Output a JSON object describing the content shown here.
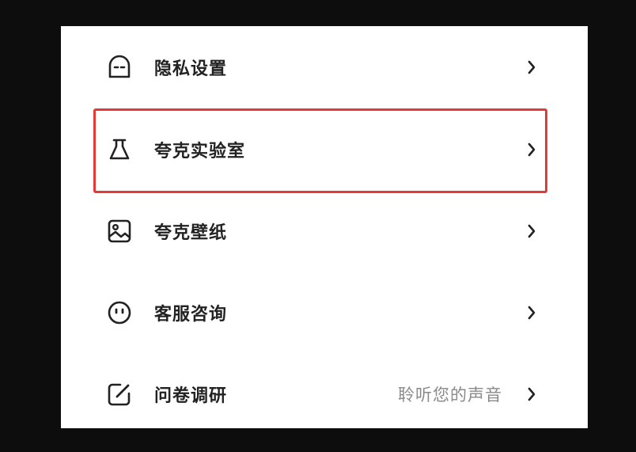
{
  "menu": {
    "items": [
      {
        "label": "隐私设置",
        "icon": "ghost-face-icon"
      },
      {
        "label": "夸克实验室",
        "icon": "flask-icon"
      },
      {
        "label": "夸克壁纸",
        "icon": "image-icon"
      },
      {
        "label": "客服咨询",
        "icon": "smiley-face-icon"
      },
      {
        "label": "问卷调研",
        "icon": "edit-square-icon",
        "hint": "聆听您的声音"
      }
    ]
  },
  "highlight": {
    "color": "#e53935",
    "target": "夸克实验室"
  }
}
